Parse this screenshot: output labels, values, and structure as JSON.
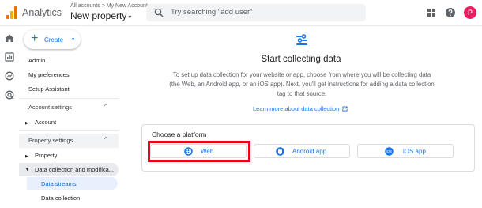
{
  "header": {
    "app_name": "Analytics",
    "breadcrumb": "All accounts > My New Account",
    "property": "New property",
    "property_caret": "▾",
    "search_placeholder": "Try searching \"add user\"",
    "avatar_initial": "P"
  },
  "sidebar": {
    "create_label": "Create",
    "create_plus": "+",
    "create_caret": "▾",
    "links": [
      "Admin",
      "My preferences",
      "Setup Assistant"
    ],
    "account_settings": {
      "label": "Account settings",
      "items": [
        "Account"
      ]
    },
    "property_settings": {
      "label": "Property settings",
      "items": [
        "Property",
        "Data collection and modifica..."
      ],
      "sub_items": [
        "Data streams",
        "Data collection"
      ]
    },
    "chevron_up": "^",
    "triangle_right": "▶",
    "triangle_down": "▼"
  },
  "main": {
    "title": "Start collecting data",
    "description": "To set up data collection for your website or app, choose from where you will be collecting data (the Web, an Android app, or an iOS app). Next, you'll get instructions for adding a data collection tag to that source.",
    "learn_more": "Learn more about data collection",
    "platform": {
      "title": "Choose a platform",
      "options": [
        "Web",
        "Android app",
        "iOS app"
      ],
      "ios_badge": "iOS"
    }
  },
  "colors": {
    "accent": "#1a73e8",
    "highlight": "#e8001c",
    "avatar": "#e91e63"
  }
}
